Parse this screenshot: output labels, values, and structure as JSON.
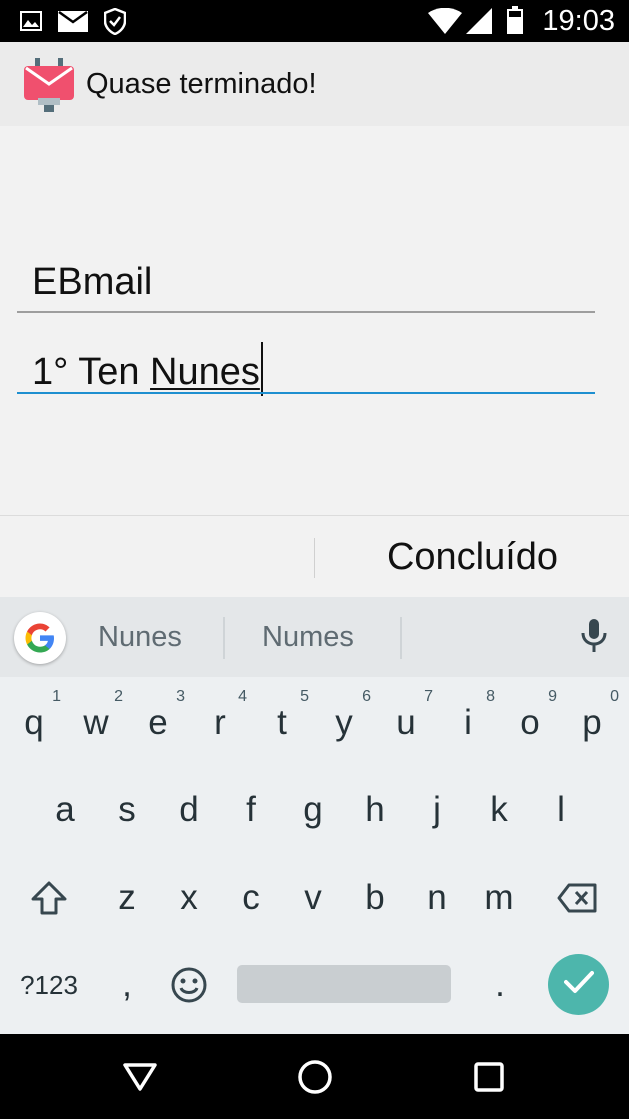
{
  "status_bar": {
    "time": "19:03",
    "icons": [
      "image-icon",
      "mail-icon",
      "shield-check-icon",
      "wifi-icon",
      "signal-icon",
      "battery-icon"
    ]
  },
  "toolbar": {
    "title": "Quase terminado!",
    "logo": "envelope-robot-logo"
  },
  "form": {
    "email_provider_value": "EBmail",
    "name_value_prefix": "1° Ten ",
    "name_value_composing": "Nunes"
  },
  "action_bar": {
    "done_label": "Concluído"
  },
  "keyboard": {
    "suggestions": [
      "Nunes",
      "Numes"
    ],
    "row1": [
      {
        "k": "q",
        "h": "1"
      },
      {
        "k": "w",
        "h": "2"
      },
      {
        "k": "e",
        "h": "3"
      },
      {
        "k": "r",
        "h": "4"
      },
      {
        "k": "t",
        "h": "5"
      },
      {
        "k": "y",
        "h": "6"
      },
      {
        "k": "u",
        "h": "7"
      },
      {
        "k": "i",
        "h": "8"
      },
      {
        "k": "o",
        "h": "9"
      },
      {
        "k": "p",
        "h": "0"
      }
    ],
    "row2": [
      "a",
      "s",
      "d",
      "f",
      "g",
      "h",
      "j",
      "k",
      "l"
    ],
    "row3": [
      "z",
      "x",
      "c",
      "v",
      "b",
      "n",
      "m"
    ],
    "symbols_label": "?123",
    "comma_label": ",",
    "period_label": ".",
    "accent_color": "#4db6ac"
  },
  "colors": {
    "focus_underline": "#1e8fd0",
    "app_logo": "#f0506e"
  }
}
